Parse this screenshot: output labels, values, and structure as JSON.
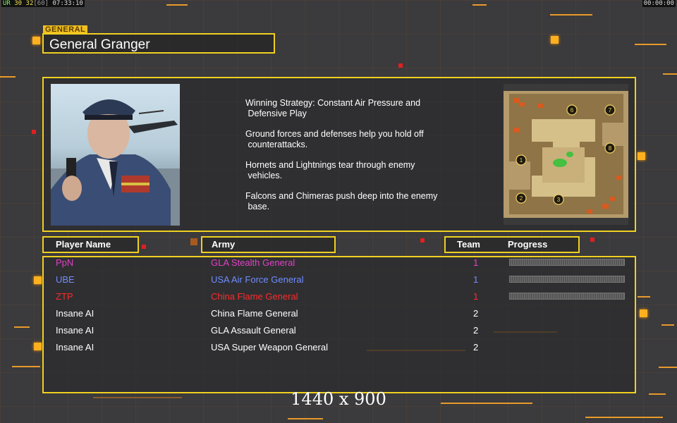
{
  "topbar": {
    "left_a": "UR",
    "left_b": "30",
    "left_c": "32",
    "left_d": "[60]",
    "left_time": "07:33:10",
    "right_time": "00:00:00"
  },
  "general": {
    "tag": "GENERAL",
    "name": "General Granger"
  },
  "strategy": [
    "Winning Strategy: Constant Air Pressure and\n Defensive Play",
    "Ground forces and defenses help you hold off\n counterattacks.",
    "Hornets and Lightnings tear through enemy\n vehicles.",
    "Falcons and Chimeras push deep into the enemy\n base."
  ],
  "minimap": {
    "slots": [
      "1",
      "2",
      "3",
      "6",
      "7",
      "8"
    ]
  },
  "columns": {
    "player": "Player Name",
    "army": "Army",
    "team": "Team",
    "progress": "Progress"
  },
  "players": [
    {
      "name": "PpN",
      "army": "GLA Stealth General",
      "team": "1",
      "color": "#e040c8",
      "progress": 0.0
    },
    {
      "name": "UBE",
      "army": "USA Air Force General",
      "team": "1",
      "color": "#6f8cff",
      "progress": 0.0
    },
    {
      "name": "ZTP",
      "army": "China Flame General",
      "team": "1",
      "color": "#ff2a2a",
      "progress": 0.0
    },
    {
      "name": "Insane AI",
      "army": "China Flame General",
      "team": "2",
      "color": "#ffffff"
    },
    {
      "name": "Insane AI",
      "army": "GLA Assault General",
      "team": "2",
      "color": "#ffffff"
    },
    {
      "name": "Insane AI",
      "army": "USA Super Weapon General",
      "team": "2",
      "color": "#ffffff"
    }
  ],
  "resolution": "1440 x 900",
  "colors": {
    "accent": "#f0d020",
    "orange": "#ffb020"
  }
}
